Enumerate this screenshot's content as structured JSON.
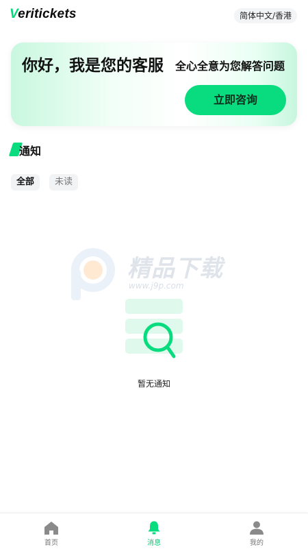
{
  "header": {
    "logo_initial": "V",
    "logo_rest": "eritickets",
    "language": "简体中文/香港"
  },
  "banner": {
    "title": "你好，我是您的客服",
    "subtitle": "全心全意为您解答问题",
    "button_label": "立即咨询"
  },
  "notifications": {
    "section_title": "通知",
    "filters": [
      "全部",
      "未读"
    ],
    "active_filter": "全部",
    "empty_text": "暂无通知"
  },
  "watermark": {
    "text": "精品下载",
    "url": "www.j9p.com"
  },
  "tabbar": {
    "items": [
      {
        "label": "首页",
        "icon": "home-icon",
        "active": false
      },
      {
        "label": "消息",
        "icon": "bell-icon",
        "active": true
      },
      {
        "label": "我的",
        "icon": "user-icon",
        "active": false
      }
    ]
  },
  "colors": {
    "accent": "#08dc7e",
    "accent_text": "#08c977",
    "inactive_icon": "#8a8a8a"
  }
}
